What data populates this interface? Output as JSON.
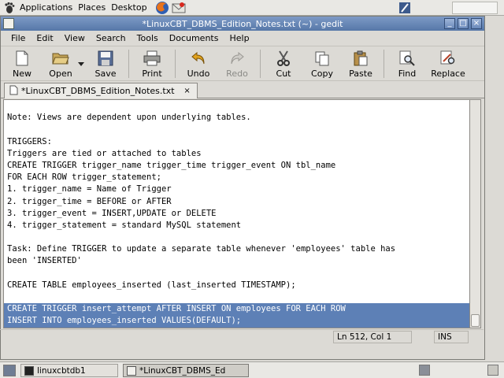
{
  "panel": {
    "menus": [
      "Applications",
      "Places",
      "Desktop"
    ]
  },
  "window": {
    "title": "*LinuxCBT_DBMS_Edition_Notes.txt (~) - gedit",
    "buttons": {
      "minimize": "_",
      "maximize": "□",
      "close": "×"
    }
  },
  "menubar": [
    "File",
    "Edit",
    "View",
    "Search",
    "Tools",
    "Documents",
    "Help"
  ],
  "toolbar": {
    "new": "New",
    "open": "Open",
    "save": "Save",
    "print": "Print",
    "undo": "Undo",
    "redo": "Redo",
    "cut": "Cut",
    "copy": "Copy",
    "paste": "Paste",
    "find": "Find",
    "replace": "Replace"
  },
  "tab": {
    "label": "*LinuxCBT_DBMS_Edition_Notes.txt",
    "close": "×"
  },
  "editor": {
    "lines": [
      "",
      "Note: Views are dependent upon underlying tables.",
      "",
      "TRIGGERS:",
      "Triggers are tied or attached to tables",
      "CREATE TRIGGER trigger_name trigger_time trigger_event ON tbl_name",
      "FOR EACH ROW trigger_statement;",
      "1. trigger_name = Name of Trigger",
      "2. trigger_time = BEFORE or AFTER",
      "3. trigger_event = INSERT,UPDATE or DELETE",
      "4. trigger_statement = standard MySQL statement",
      "",
      "Task: Define TRIGGER to update a separate table whenever 'employees' table has",
      "been 'INSERTED'",
      "",
      "CREATE TABLE employees_inserted (last_inserted TIMESTAMP);",
      "",
      "CREATE TRIGGER insert_attempt AFTER INSERT ON employees FOR EACH ROW",
      "INSERT INTO employees_inserted VALUES(DEFAULT);"
    ],
    "selected_lines": [
      17,
      18
    ]
  },
  "status": {
    "position": "Ln 512, Col 1",
    "mode": "INS"
  },
  "taskbar": {
    "tasks": [
      "linuxcbtdb1",
      "*LinuxCBT_DBMS_Ed"
    ]
  },
  "colors": {
    "titlebar": "#5e7fb0",
    "selection": "#5d80b6"
  }
}
